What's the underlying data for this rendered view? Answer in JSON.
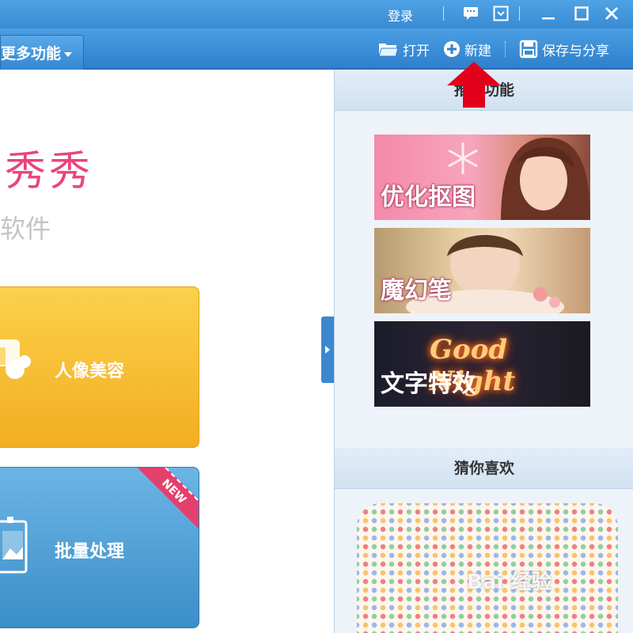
{
  "titlebar": {
    "login_label": "登录",
    "icons": [
      "message-icon",
      "skin-icon",
      "minimize-icon",
      "maximize-icon",
      "close-icon"
    ]
  },
  "toolbar": {
    "more_label": "更多功能",
    "open_label": "打开",
    "new_label": "新建",
    "save_share_label": "保存与分享"
  },
  "main": {
    "brand_title": "秀秀",
    "brand_subtitle": "软件",
    "buttons": [
      {
        "label": "人像美容"
      },
      {
        "label": "批量处理",
        "badge": "NEW"
      }
    ]
  },
  "sidebar": {
    "recommended_title": "推荐功能",
    "features": [
      {
        "label": "优化抠图"
      },
      {
        "label": "魔幻笔"
      },
      {
        "label": "文字特效",
        "script": "Good Night"
      }
    ],
    "guess_title": "猜你喜欢"
  },
  "watermark": "Bai 经验",
  "colors": {
    "titlebar": "#3a8bd3",
    "brand_pink": "#e8457d",
    "yellow_button": "#f3ad22",
    "blue_button": "#3b8ec8",
    "annotation_arrow": "#e3001b"
  }
}
